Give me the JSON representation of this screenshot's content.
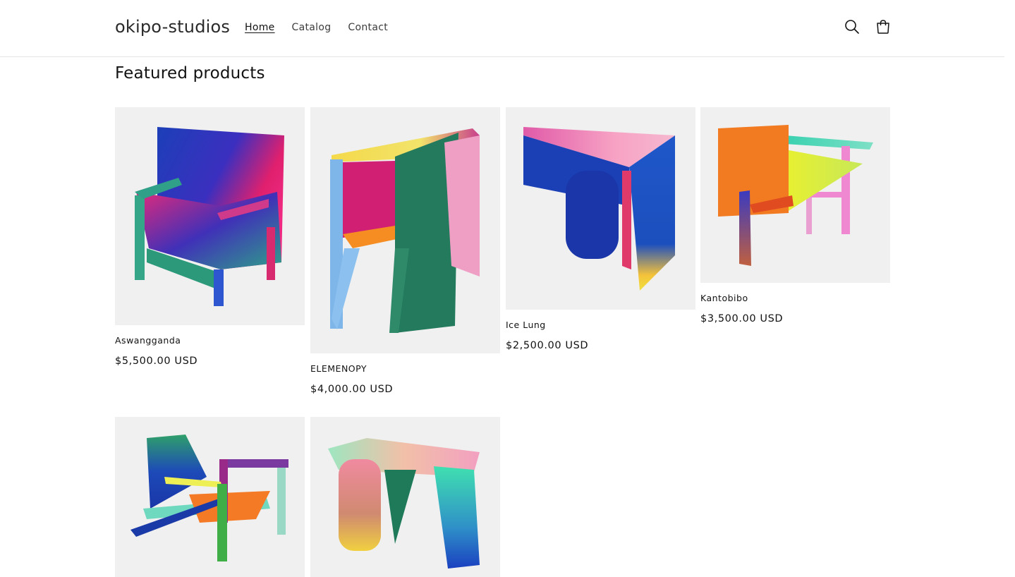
{
  "header": {
    "logo": "okipo-studios",
    "nav": [
      {
        "label": "Home",
        "active": true
      },
      {
        "label": "Catalog",
        "active": false
      },
      {
        "label": "Contact",
        "active": false
      }
    ],
    "icons": [
      "search-icon",
      "cart-icon"
    ]
  },
  "section": {
    "title": "Featured products"
  },
  "products": [
    {
      "name": "Aswangganda",
      "price": "$5,500.00 USD"
    },
    {
      "name": "ELEMENOPY",
      "price": "$4,000.00 USD"
    },
    {
      "name": "Ice Lung",
      "price": "$2,500.00 USD"
    },
    {
      "name": "Kantobibo",
      "price": "$3,500.00 USD"
    },
    {
      "name": "",
      "price": ""
    },
    {
      "name": "",
      "price": ""
    }
  ],
  "colors": {
    "image_bg": "#f0f0f0",
    "text": "#121212",
    "border": "#e4e4e4"
  }
}
